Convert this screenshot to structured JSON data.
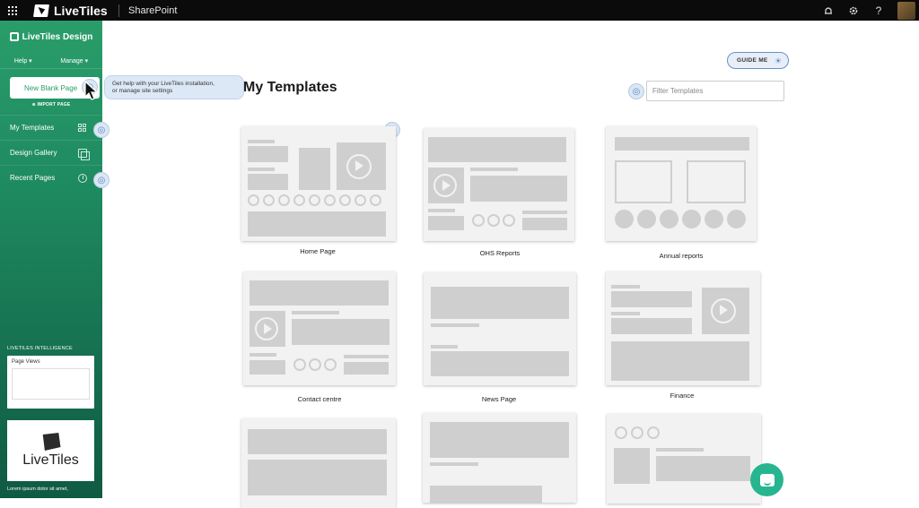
{
  "topbar": {
    "brand": "LiveTiles",
    "app": "SharePoint",
    "icons": [
      "app-launcher-icon",
      "notifications-icon",
      "settings-icon",
      "help-icon",
      "avatar"
    ],
    "help_glyph": "?"
  },
  "sidebar": {
    "logo_text": "LiveTiles Design",
    "menus": {
      "help": "Help ▾",
      "manage": "Manage ▾"
    },
    "new_page_label": "New Blank Page",
    "import_label": "⊕ IMPORT PAGE",
    "nav": [
      {
        "label": "My Templates",
        "icon": "grid-icon"
      },
      {
        "label": "Design Gallery",
        "icon": "gallery-icon"
      },
      {
        "label": "Recent Pages",
        "icon": "clock-icon"
      }
    ],
    "intelligence_label": "LIVETILES INTELLIGENCE",
    "page_views_label": "Page Views",
    "logo_card_text": "LiveTiles",
    "lorem": "Lorem ipsum dolor sit amet,"
  },
  "tooltip": {
    "line1": "Get help with your LiveTiles installation,",
    "line2": "or manage site settings"
  },
  "main": {
    "title": "My Templates",
    "guide_label": "GUIDE ME",
    "filter_placeholder": "Filter Templates",
    "templates": [
      {
        "label": "Home Page"
      },
      {
        "label": "OHS Reports"
      },
      {
        "label": "Annual reports"
      },
      {
        "label": "Contact centre"
      },
      {
        "label": "News Page"
      },
      {
        "label": "Finance"
      },
      {
        "label": ""
      },
      {
        "label": ""
      },
      {
        "label": ""
      }
    ]
  },
  "colors": {
    "accent": "#2a9d6a",
    "topbar": "#0b0b0b",
    "hint": "#dce8f6",
    "chat": "#27b590"
  }
}
